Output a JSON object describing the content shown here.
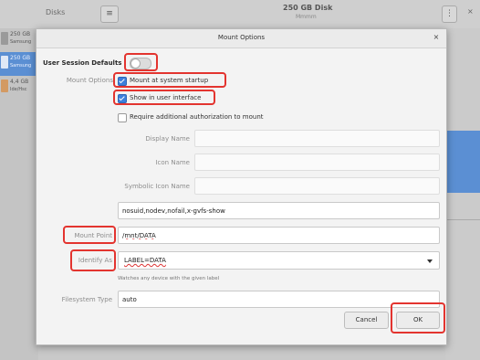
{
  "background_app": {
    "title": "Disks",
    "menu_icon": "hamburger-icon",
    "disk_title": "250 GB Disk",
    "disk_subtitle": "Mmmm",
    "kebab_icon": "kebab-icon",
    "close_glyph": "×",
    "disk_list": [
      {
        "line1": "250 GB",
        "line2": "Samsung",
        "selected": false
      },
      {
        "line1": "250 GB",
        "line2": "Samsung",
        "selected": true
      },
      {
        "line1": "4,4 GB",
        "line2": "Ide/Hsc",
        "selected": false
      }
    ]
  },
  "dialog": {
    "title": "Mount Options",
    "close_glyph": "×",
    "user_session_defaults_label": "User Session Defaults",
    "user_session_defaults_on": false,
    "mount_options_label": "Mount Options",
    "checkboxes": [
      {
        "label": "Mount at system startup",
        "checked": true
      },
      {
        "label": "Show in user interface",
        "checked": true
      },
      {
        "label": "Require additional authorization to mount",
        "checked": false
      }
    ],
    "display_name_label": "Display Name",
    "display_name_value": "",
    "icon_name_label": "Icon Name",
    "icon_name_value": "",
    "symbolic_icon_name_label": "Symbolic Icon Name",
    "symbolic_icon_name_value": "",
    "options_value": "nosuid,nodev,nofail,x-gvfs-show",
    "mount_point_label": "Mount Point",
    "mount_point_value": "/mnt/DATA",
    "identify_as_label": "Identify As",
    "identify_as_value": "LABEL=DATA",
    "identify_hint": "Watches any device with the given label",
    "filesystem_type_label": "Filesystem Type",
    "filesystem_type_value": "auto",
    "cancel_label": "Cancel",
    "ok_label": "OK"
  },
  "colors": {
    "highlight": "#e3342f",
    "accent": "#3c7fdc",
    "selection": "#5b8fd3"
  }
}
